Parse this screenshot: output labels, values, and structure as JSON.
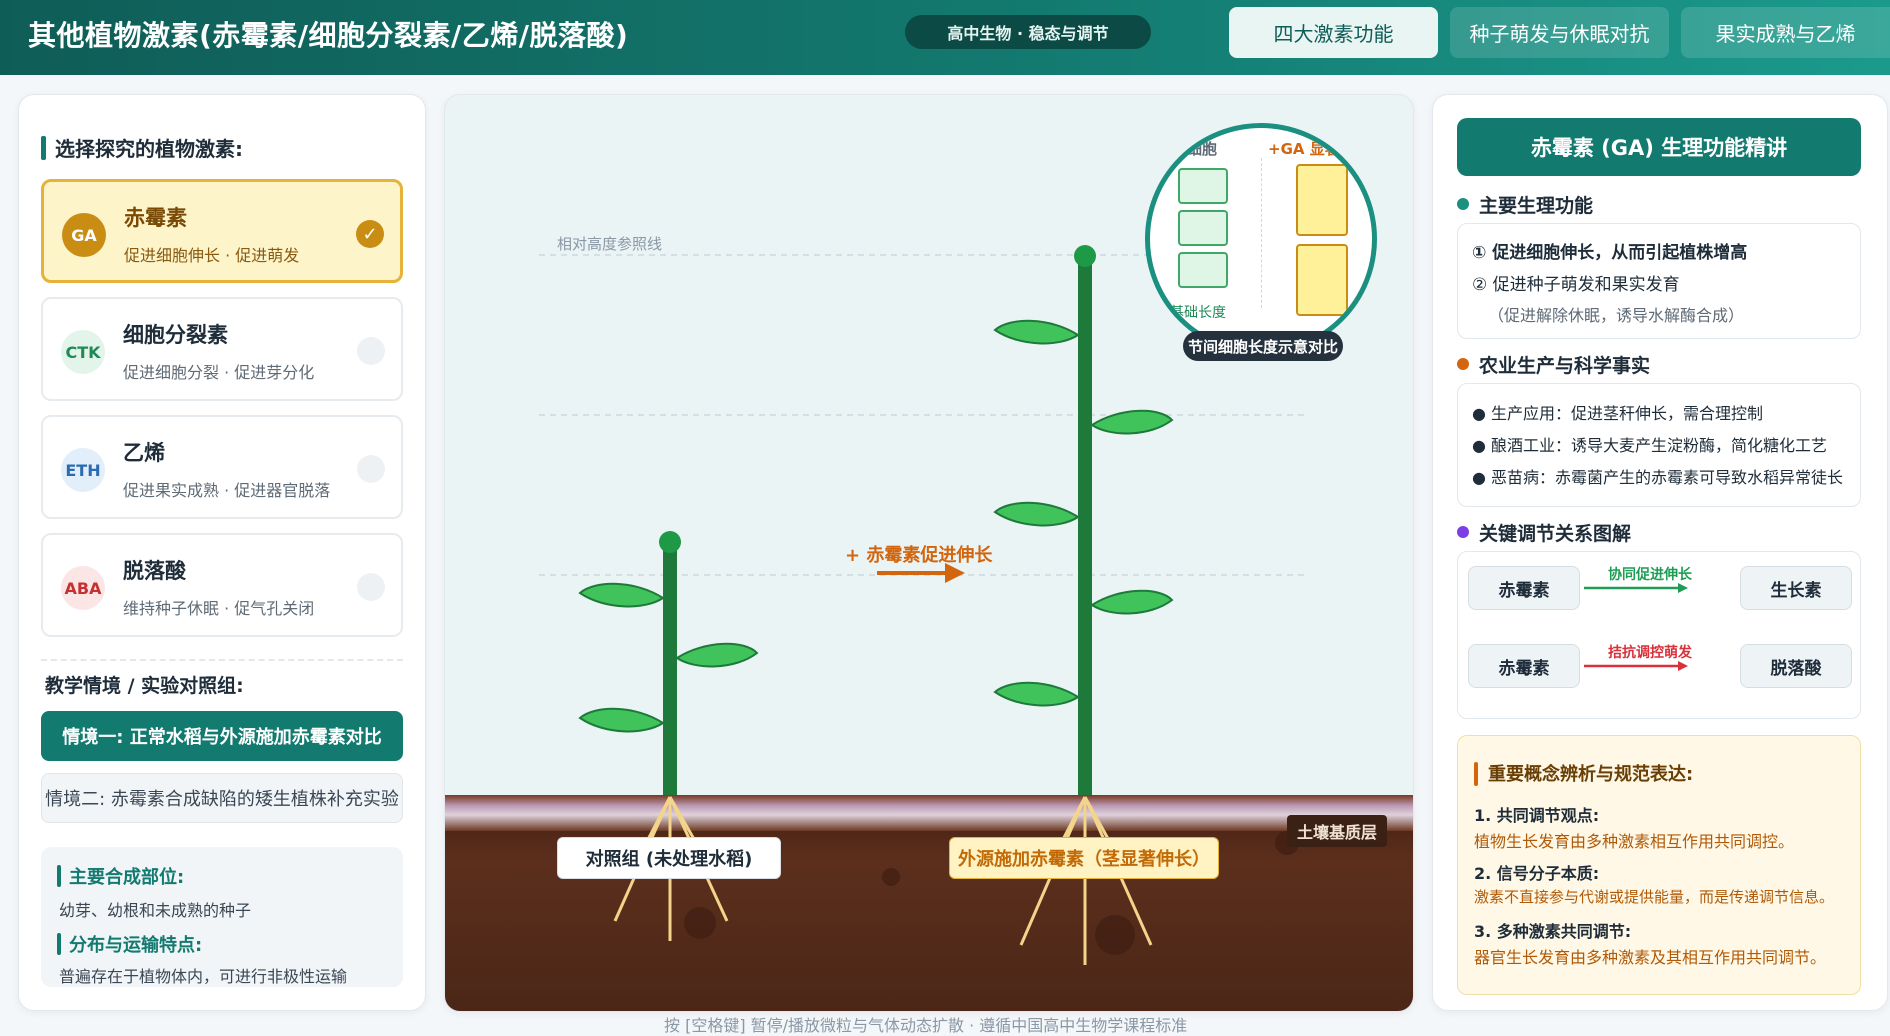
{
  "header": {
    "title": "其他植物激素(赤霉素/细胞分裂素/乙烯/脱落酸)",
    "subject_badge": "高中生物 · 稳态与调节",
    "tabs": [
      {
        "label": "四大激素功能",
        "active": true
      },
      {
        "label": "种子萌发与休眠对抗",
        "active": false
      },
      {
        "label": "果实成熟与乙烯",
        "active": false
      }
    ]
  },
  "left": {
    "select_heading": "选择探究的植物激素:",
    "hormones": [
      {
        "abbr": "GA",
        "name": "赤霉素",
        "desc": "促进细胞伸长 · 促进萌发",
        "selected": true,
        "color": "#c98d14",
        "bg": "#c98d14"
      },
      {
        "abbr": "CTK",
        "name": "细胞分裂素",
        "desc": "促进细胞分裂 · 促进芽分化",
        "selected": false,
        "color": "#1f8a55",
        "bg": "#e3f5ea"
      },
      {
        "abbr": "ETH",
        "name": "乙烯",
        "desc": "促进果实成熟 · 促进器官脱落",
        "selected": false,
        "color": "#2b6cb0",
        "bg": "#e2eefa"
      },
      {
        "abbr": "ABA",
        "name": "脱落酸",
        "desc": "维持种子休眠 · 促气孔关闭",
        "selected": false,
        "color": "#c53030",
        "bg": "#fbe5e5"
      }
    ],
    "scenario_heading": "教学情境 / 实验对照组:",
    "scenarios": [
      {
        "label": "情境一: 正常水稻与外源施加赤霉素对比",
        "active": true
      },
      {
        "label": "情境二: 赤霉素合成缺陷的矮生植株补充实验",
        "active": false
      }
    ],
    "info": {
      "site_heading": "主要合成部位:",
      "site_text": "幼芽、幼根和未成熟的种子",
      "transport_heading": "分布与运输特点:",
      "transport_text": "普遍存在于植物体内，可进行非极性运输"
    }
  },
  "scene": {
    "ref_line_label": "相对高度参照线",
    "arrow_label": "+ 赤霉素促进伸长",
    "control_label": "对照组 (未处理水稻)",
    "treated_label": "外源施加赤霉素（茎显著伸长）",
    "soil_label": "土壤基质层",
    "zoom": {
      "left_heading": "原细胞",
      "right_heading": "+GA 显著",
      "base_label": "基础长度",
      "caption": "节间细胞长度示意对比"
    },
    "footer": "按 [空格键] 暂停/播放微粒与气体动态扩散 · 遵循中国高中生物学课程标准"
  },
  "right": {
    "feature_title": "赤霉素 (GA) 生理功能精讲",
    "functions_heading": "主要生理功能",
    "functions": [
      "① 促进细胞伸长，从而引起植株增高",
      "② 促进种子萌发和果实发育",
      "（促进解除休眠，诱导水解酶合成）"
    ],
    "agri_heading": "农业生产与科学事实",
    "agri": [
      "生产应用：促进茎秆伸长，需合理控制",
      "酿酒工业：诱导大麦产生淀粉酶，简化糖化工艺",
      "恶苗病：赤霉菌产生的赤霉素可导致水稻异常徒长"
    ],
    "relations_heading": "关键调节关系图解",
    "relations": [
      {
        "from": "赤霉素",
        "label": "协同促进伸长",
        "to": "生长素",
        "color": "#1f9d55"
      },
      {
        "from": "赤霉素",
        "label": "拮抗调控萌发",
        "to": "脱落酸",
        "color": "#d9303a"
      }
    ],
    "concept_heading": "重要概念辨析与规范表达:",
    "concepts": [
      {
        "title": "1. 共同调节观点:",
        "text": "植物生长发育由多种激素相互作用共同调控。"
      },
      {
        "title": "2. 信号分子本质:",
        "text": "激素不直接参与代谢或提供能量，而是传递调节信息。"
      },
      {
        "title": "3. 多种激素共同调节:",
        "text": "器官生长发育由多种激素及其相互作用共同调节。"
      }
    ],
    "dot_colors": {
      "functions": "#1b8f80",
      "agri": "#d2650d",
      "relations": "#7b3fe4"
    }
  }
}
